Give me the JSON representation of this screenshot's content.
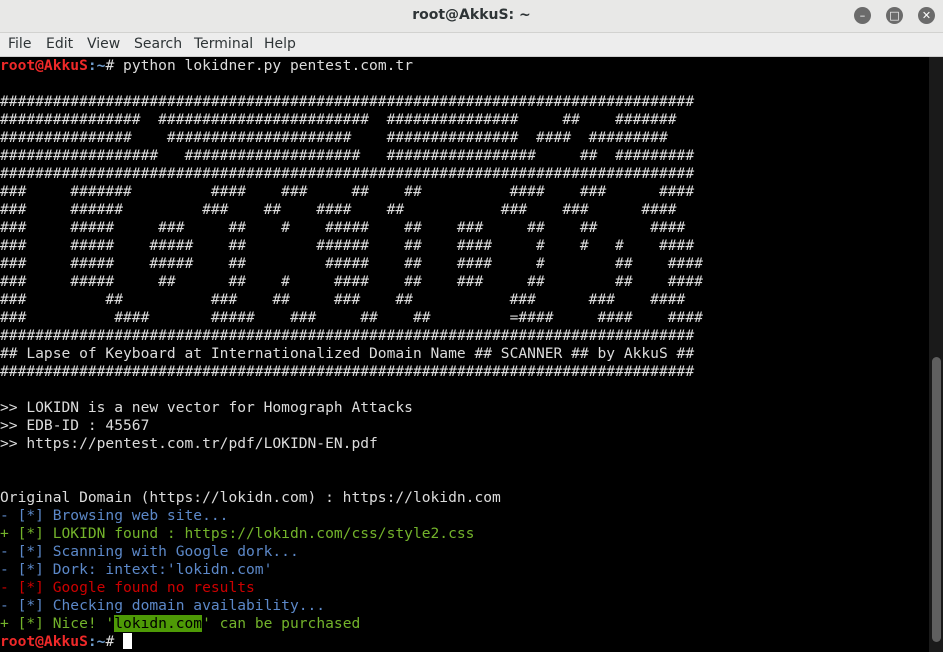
{
  "window": {
    "title": "root@AkkuS: ~"
  },
  "menu": {
    "file": "File",
    "edit": "Edit",
    "view": "View",
    "search": "Search",
    "terminal": "Terminal",
    "help": "Help"
  },
  "prompt": {
    "user": "root@AkkuS",
    "path": ":~",
    "symbol": "# "
  },
  "command": "python lokidner.py pentest.com.tr",
  "banner": [
    "###############################################################################",
    "################  ########################  ###############     ##    #######",
    "###############    #####################    ###############  ####  #########",
    "##################   ####################   #################     ##  #########",
    "###############################################################################",
    "###     #######         ####    ###     ##    ##          ####    ###      ####",
    "###     ######         ###    ##    ####    ##           ###    ###      ####",
    "###     #####     ###     ##    #    #####    ##    ###     ##    ##      ####",
    "###     #####    #####    ##        ######    ##    ####     #    #   #    ####",
    "###     #####    #####    ##         #####    ##    ####     #        ##    ####",
    "###     #####     ##      ##    #     ####    ##    ###     ##        ##    ####",
    "###         ##          ###    ##     ###    ##           ###      ###    ####",
    "###          ####       #####    ###     ##    ##         =####     ####    ####",
    "###############################################################################",
    "## Lapse of Keyboard at Internationalized Domain Name ## SCANNER ## by AkkuS ##",
    "###############################################################################"
  ],
  "info": [
    ">> LOKIDN is a new vector for Homograph Attacks",
    ">> EDB-ID : 45567",
    ">> https://pentest.com.tr/pdf/LOKIDN-EN.pdf"
  ],
  "original_domain": "Original Domain (https://lokidn.com) : https://lokidn.com",
  "results": {
    "browsing": "- [*] Browsing web site...",
    "found": "+ [*] LOKIDN found : https://lokıdn.com/css/style2.css",
    "scanning": "- [*] Scanning with Google dork...",
    "dork": "- [*] Dork: intext:'lokidn.com'",
    "no_results": "- [*] Google found no results",
    "checking": "- [*] Checking domain availability...",
    "nice_prefix": "+ [*] Nice! '",
    "nice_domain": "lokıdn.com",
    "nice_suffix": "' can be purchased"
  },
  "colors": {
    "prompt_user": "#ef2929",
    "prompt_path": "#729fcf",
    "status_blue": "#5c88c8",
    "status_green": "#8ae234",
    "status_red": "#cc0000"
  }
}
